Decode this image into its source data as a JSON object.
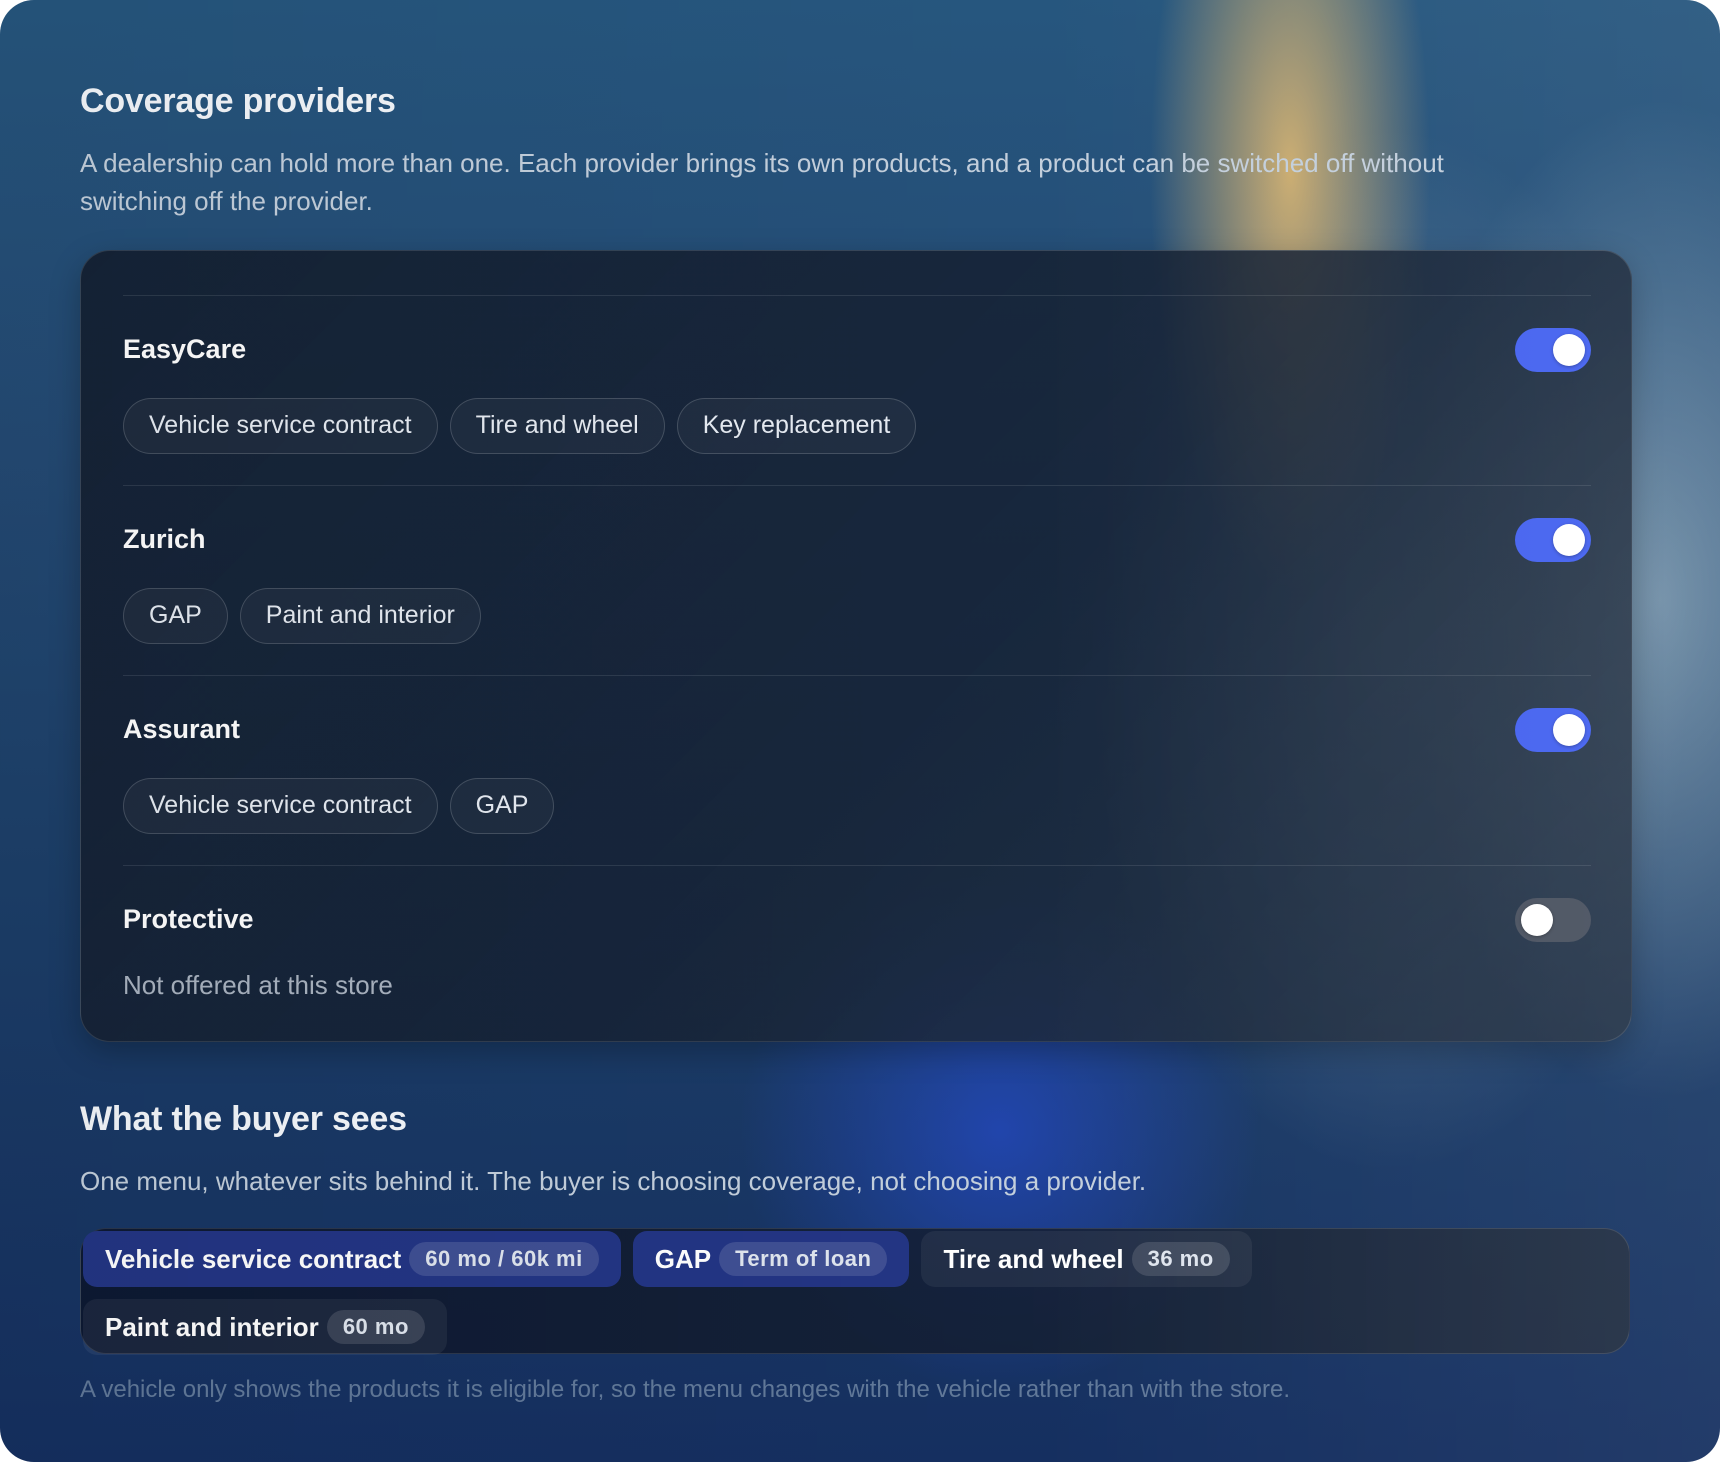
{
  "coverage": {
    "title": "Coverage providers",
    "description": "A dealership can hold more than one. Each provider brings its own products, and a product can be switched off without switching off the provider."
  },
  "providers": [
    {
      "name": "EasyCare",
      "enabled": true,
      "products": [
        "Vehicle service contract",
        "Tire and wheel",
        "Key replacement"
      ]
    },
    {
      "name": "Zurich",
      "enabled": true,
      "products": [
        "GAP",
        "Paint and interior"
      ]
    },
    {
      "name": "Assurant",
      "enabled": true,
      "products": [
        "Vehicle service contract",
        "GAP"
      ]
    },
    {
      "name": "Protective",
      "enabled": false,
      "products": [],
      "note": "Not offered at this store"
    }
  ],
  "buyer": {
    "title": "What the buyer sees",
    "description": "One menu, whatever sits behind it. The buyer is choosing coverage, not choosing a provider.",
    "menu": [
      {
        "label": "Vehicle service contract",
        "badge": "60 mo / 60k mi",
        "active": true
      },
      {
        "label": "GAP",
        "badge": "Term of loan",
        "active": true
      },
      {
        "label": "Tire and wheel",
        "badge": "36 mo",
        "active": false
      },
      {
        "label": "Paint and interior",
        "badge": "60 mo",
        "active": false
      }
    ],
    "footnote": "A vehicle only shows the products it is eligible for, so the menu changes with the vehicle rather than with the store."
  },
  "colors": {
    "toggle_on": "#4462ef",
    "toggle_off": "#4a5260",
    "menu_active": "#233584"
  }
}
